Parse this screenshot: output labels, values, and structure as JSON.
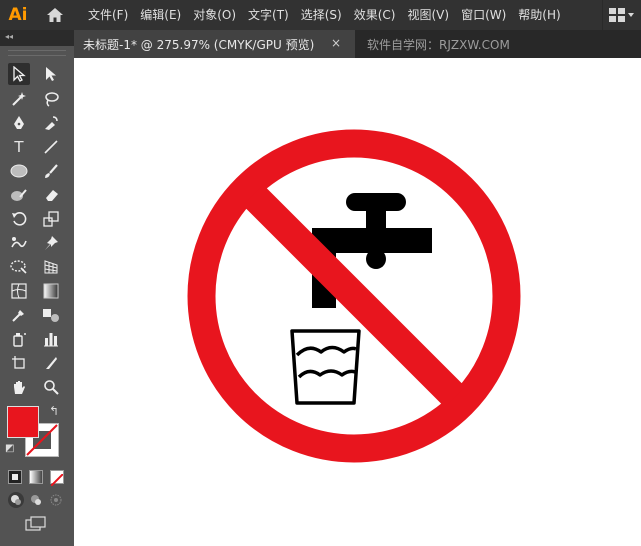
{
  "app": {
    "logo": "Ai"
  },
  "menu": {
    "items": [
      "文件(F)",
      "编辑(E)",
      "对象(O)",
      "文字(T)",
      "选择(S)",
      "效果(C)",
      "视图(V)",
      "窗口(W)",
      "帮助(H)"
    ]
  },
  "tabs": {
    "active_title": "未标题-1* @ 275.97% (CMYK/GPU 预览)",
    "close_glyph": "×"
  },
  "watermark": "软件自学网：RJZXW.COM",
  "toolbar": {
    "collapse_glyph": "◂◂",
    "text_tool_glyph": "T",
    "swap_glyph": "↰",
    "default_glyph": "◩"
  },
  "colors": {
    "fill": "#e8151e",
    "stroke": "none",
    "sign_red": "#e8151e",
    "icon_black": "#000000"
  },
  "artwork": {
    "description_icons": [
      "prohibition-sign-icon",
      "faucet-icon",
      "water-glass-icon"
    ]
  }
}
